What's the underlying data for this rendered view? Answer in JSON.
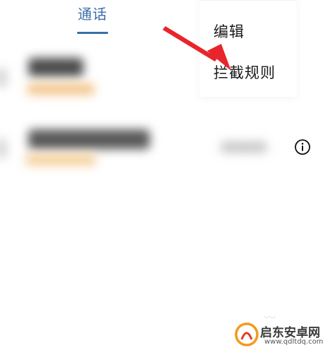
{
  "tabs": [
    {
      "label": "通话",
      "active": true
    }
  ],
  "menu": {
    "items": [
      {
        "label": "编辑"
      },
      {
        "label": "拦截规则"
      }
    ]
  },
  "icons": {
    "info": "info-circle-icon",
    "annotation": "red-arrow-annotation"
  },
  "colors": {
    "tab_active": "#3a6ea8",
    "arrow": "#e8252b",
    "blurred_subtext": "#f3c48b"
  },
  "watermark": {
    "title": "启东安卓网",
    "url": "www.qdltdq.com"
  }
}
